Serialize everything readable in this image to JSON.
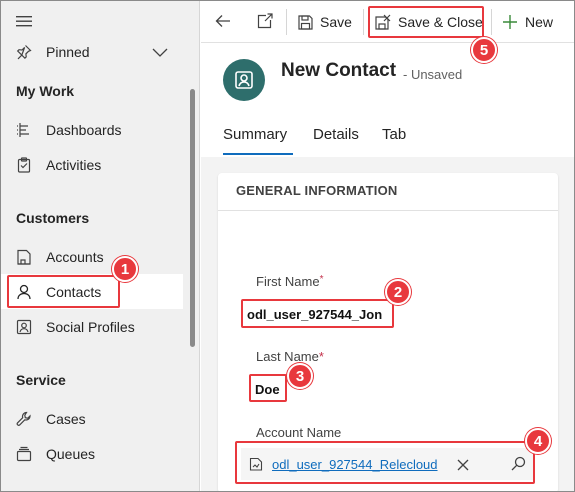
{
  "sidebar": {
    "menu_icon": "hamburger-icon",
    "pinned": {
      "label": "Pinned",
      "icon": "pin-icon",
      "chevron": "chevron-down-icon"
    },
    "groups": [
      {
        "title": "My Work",
        "items": [
          {
            "label": "Dashboards",
            "icon": "dashboard-icon"
          },
          {
            "label": "Activities",
            "icon": "clipboard-icon"
          }
        ]
      },
      {
        "title": "Customers",
        "items": [
          {
            "label": "Accounts",
            "icon": "building-icon"
          },
          {
            "label": "Contacts",
            "icon": "person-icon",
            "selected": true
          },
          {
            "label": "Social Profiles",
            "icon": "profile-card-icon"
          }
        ]
      },
      {
        "title": "Service",
        "items": [
          {
            "label": "Cases",
            "icon": "wrench-icon"
          },
          {
            "label": "Queues",
            "icon": "queue-icon"
          }
        ]
      }
    ]
  },
  "toolbar": {
    "back_icon": "back-arrow-icon",
    "popout_icon": "open-new-window-icon",
    "save_label": "Save",
    "save_close_label": "Save & Close",
    "new_label": "New"
  },
  "record": {
    "title": "New Contact",
    "subtitle": "- Unsaved",
    "avatar_icon": "contact-avatar-icon"
  },
  "tabs": [
    {
      "label": "Summary",
      "active": true
    },
    {
      "label": "Details"
    },
    {
      "label": "Tab"
    }
  ],
  "form": {
    "section_title": "GENERAL INFORMATION",
    "first_name": {
      "label": "First Name",
      "required_mark": "*",
      "value": "odl_user_927544_Jon"
    },
    "last_name": {
      "label": "Last Name",
      "required_mark": "*",
      "value": "Doe"
    },
    "account_name": {
      "label": "Account Name",
      "value": "odl_user_927544_Relecloud"
    }
  },
  "annotations": [
    "1",
    "2",
    "3",
    "4",
    "5"
  ],
  "colors": {
    "accent": "#0f6cbd",
    "highlight": "#e8383d",
    "avatar": "#2e6e6c",
    "new_plus": "#3a8a3a",
    "sidebar_bg": "#f0f0f0"
  }
}
